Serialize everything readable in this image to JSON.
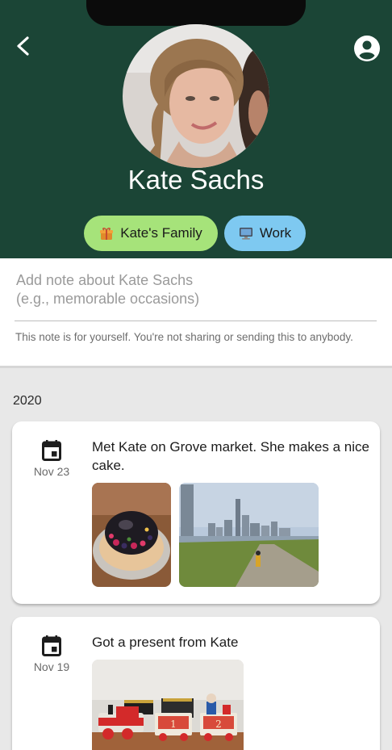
{
  "contact": {
    "name": "Kate Sachs"
  },
  "tags": [
    {
      "label": "Kate's Family",
      "icon": "gift-icon",
      "color": "#a6e37a"
    },
    {
      "label": "Work",
      "icon": "computer-icon",
      "color": "#7ec9f1"
    }
  ],
  "note": {
    "placeholder": "Add note about Kate Sachs\n(e.g., memorable occasions)",
    "helper": "This note is for yourself. You're not sharing or sending this to anybody."
  },
  "timeline": {
    "year": "2020",
    "events": [
      {
        "date": "Nov 23",
        "text": "Met Kate on Grove market. She makes a nice cake.",
        "photos": [
          "cake-photo",
          "city-skyline-photo"
        ]
      },
      {
        "date": "Nov 19",
        "text": "Got a present from Kate",
        "photos": [
          "toy-train-photo"
        ]
      }
    ]
  },
  "colors": {
    "header": "#1b4536",
    "background": "#e8e8e8"
  }
}
